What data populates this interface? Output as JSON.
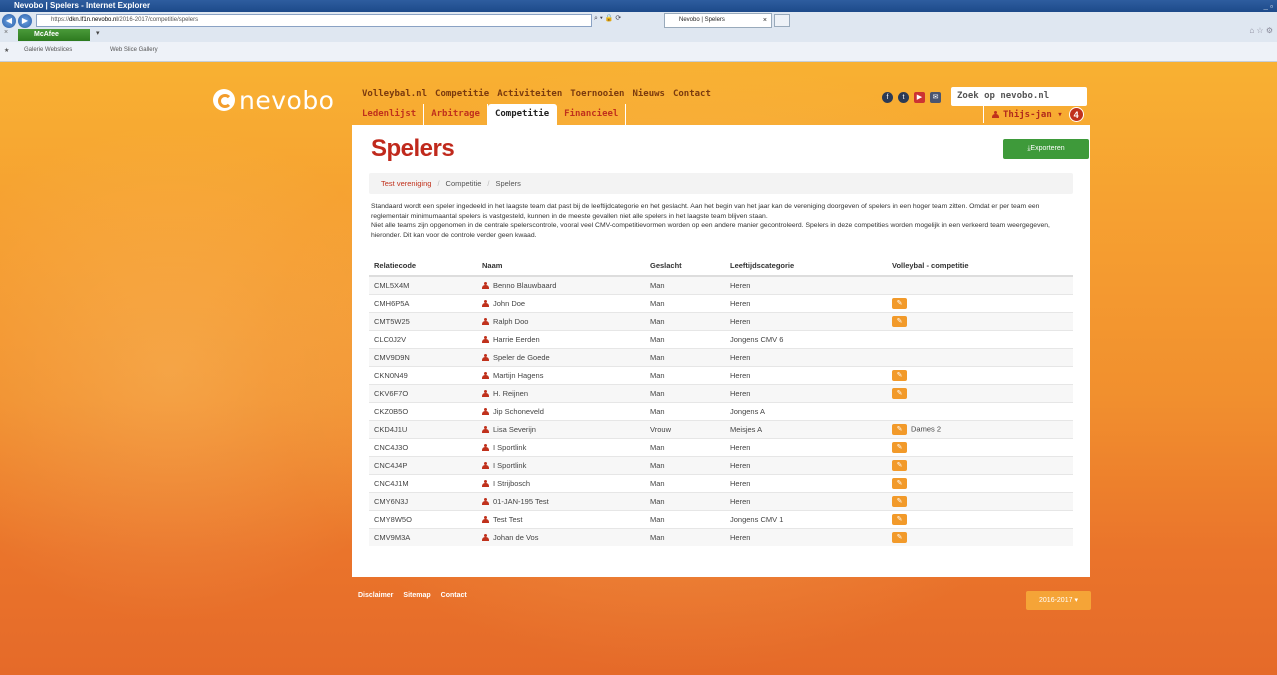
{
  "browser": {
    "window_title": "Nevobo | Spelers - Internet Explorer",
    "address_host": "https://",
    "address_domain": "dkn.lf1n.nevobo.nl",
    "address_path": "/2016-2017/competitie/spelers",
    "tab_title": "Nevobo | Spelers",
    "toolbar_label": "McAfee",
    "favorites": [
      "Galerie Webslices",
      "Web Slice Gallery"
    ]
  },
  "site": {
    "logo_text": "nevobo",
    "main_nav": [
      "Volleybal.nl",
      "Competitie",
      "Activiteiten",
      "Toernooien",
      "Nieuws",
      "Contact"
    ],
    "sub_nav": [
      "Ledenlijst",
      "Arbitrage",
      "Competitie",
      "Financieel"
    ],
    "search_placeholder": "Zoek op nevobo.nl",
    "user_name": "Thijs-jan",
    "notification_count": "4"
  },
  "main": {
    "title": "Spelers",
    "export_label": "Exporteren",
    "breadcrumb": [
      "Test vereniging",
      "Competitie",
      "Spelers"
    ],
    "intro_p1": "Standaard wordt een speler ingedeeld in het laagste team dat past bij de leeftijdcategorie en het geslacht. Aan het begin van het jaar kan de vereniging doorgeven of spelers in een hoger team zitten. Omdat er per team een reglementair minimumaantal spelers is vastgesteld, kunnen in de meeste gevallen niet alle spelers in het laagste team blijven staan.",
    "intro_p2": "Niet alle teams zijn opgenomen in de centrale spelerscontrole, vooral veel CMV-competitievormen worden op een andere manier gecontroleerd. Spelers in deze competities worden mogelijk in een verkeerd team weergegeven, hieronder. Dit kan voor de controle verder geen kwaad.",
    "columns": [
      "Relatiecode",
      "Naam",
      "Geslacht",
      "Leeftijdscategorie",
      "Volleybal - competitie"
    ],
    "rows": [
      {
        "code": "CML5X4M",
        "name": "Benno Blauwbaard",
        "gender": "Man",
        "category": "Heren",
        "edit": false,
        "team": ""
      },
      {
        "code": "CMH6P5A",
        "name": "John Doe",
        "gender": "Man",
        "category": "Heren",
        "edit": true,
        "team": ""
      },
      {
        "code": "CMT5W25",
        "name": "Ralph Doo",
        "gender": "Man",
        "category": "Heren",
        "edit": true,
        "team": ""
      },
      {
        "code": "CLC0J2V",
        "name": "Harrie Eerden",
        "gender": "Man",
        "category": "Jongens CMV 6",
        "edit": false,
        "team": ""
      },
      {
        "code": "CMV9D9N",
        "name": "Speler de Goede",
        "gender": "Man",
        "category": "Heren",
        "edit": false,
        "team": ""
      },
      {
        "code": "CKN0N49",
        "name": "Martijn Hagens",
        "gender": "Man",
        "category": "Heren",
        "edit": true,
        "team": ""
      },
      {
        "code": "CKV6F7O",
        "name": "H. Reijnen",
        "gender": "Man",
        "category": "Heren",
        "edit": true,
        "team": ""
      },
      {
        "code": "CKZ0B5O",
        "name": "Jip Schoneveld",
        "gender": "Man",
        "category": "Jongens A",
        "edit": false,
        "team": ""
      },
      {
        "code": "CKD4J1U",
        "name": "Lisa Severijn",
        "gender": "Vrouw",
        "category": "Meisjes A",
        "edit": true,
        "team": "Dames 2"
      },
      {
        "code": "CNC4J3O",
        "name": "I Sportlink",
        "gender": "Man",
        "category": "Heren",
        "edit": true,
        "team": ""
      },
      {
        "code": "CNC4J4P",
        "name": "I Sportlink",
        "gender": "Man",
        "category": "Heren",
        "edit": true,
        "team": ""
      },
      {
        "code": "CNC4J1M",
        "name": "I Strijbosch",
        "gender": "Man",
        "category": "Heren",
        "edit": true,
        "team": ""
      },
      {
        "code": "CMY6N3J",
        "name": "01-JAN-195 Test",
        "gender": "Man",
        "category": "Heren",
        "edit": true,
        "team": ""
      },
      {
        "code": "CMY8W5O",
        "name": "Test Test",
        "gender": "Man",
        "category": "Jongens CMV 1",
        "edit": true,
        "team": ""
      },
      {
        "code": "CMV9M3A",
        "name": "Johan de Vos",
        "gender": "Man",
        "category": "Heren",
        "edit": true,
        "team": ""
      }
    ]
  },
  "footer": {
    "links": [
      "Disclaimer",
      "Sitemap",
      "Contact"
    ],
    "season": "2016-2017"
  }
}
